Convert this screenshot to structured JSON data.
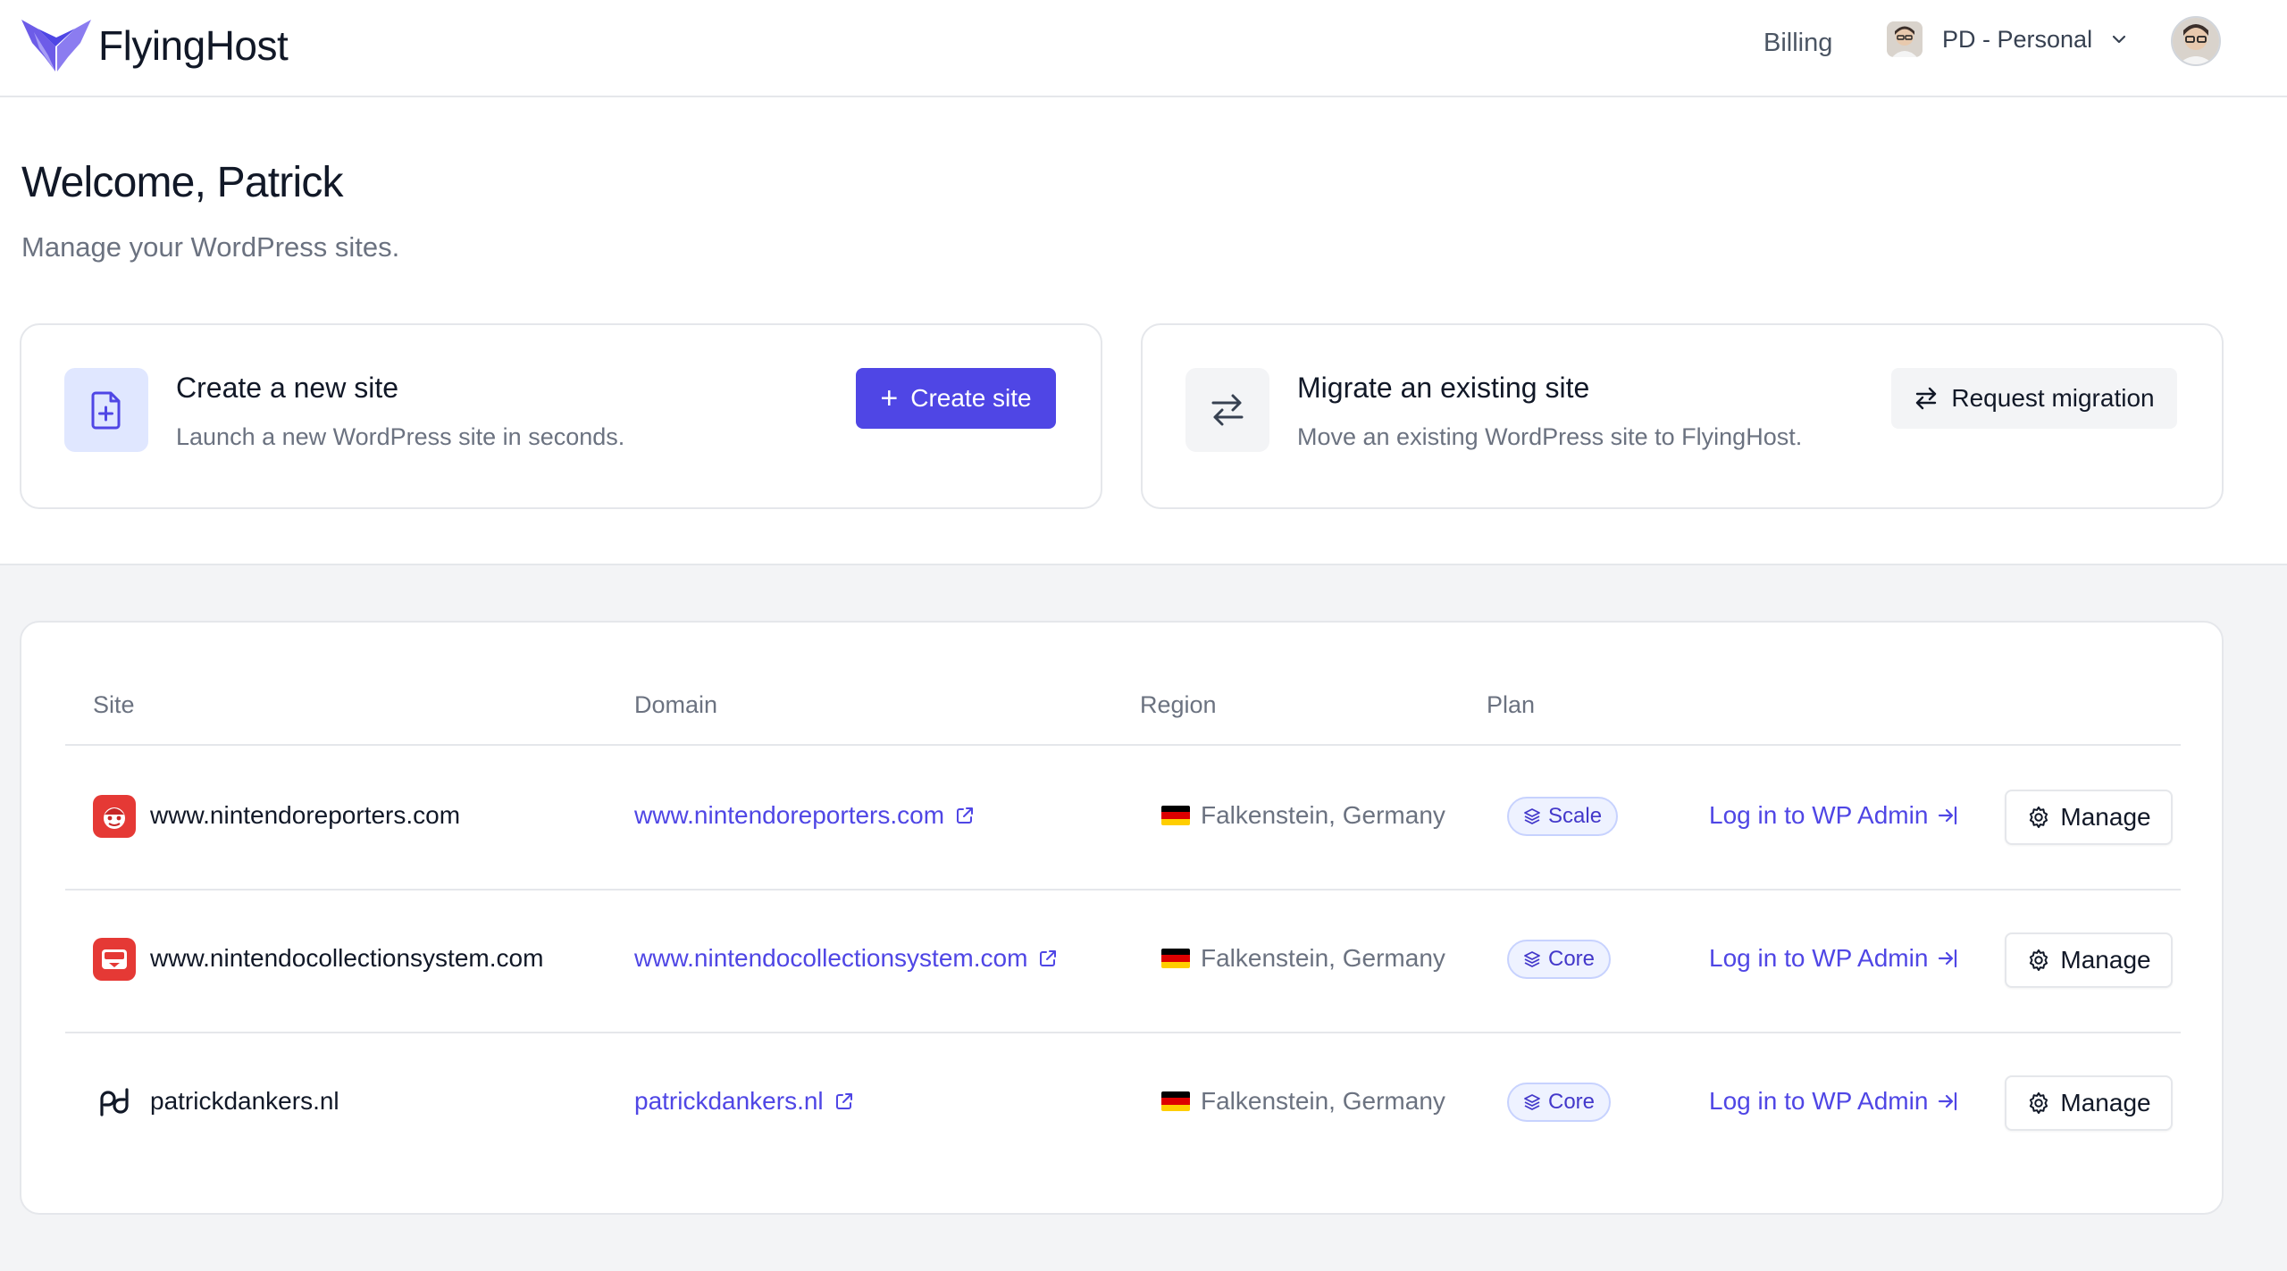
{
  "header": {
    "brand": "FlyingHost",
    "billing_label": "Billing",
    "org_label": "PD - Personal",
    "icons": {
      "logo": "flyinghost-logo",
      "org_avatar": "avatar-icon",
      "org_chevron": "chevron-down-icon",
      "user_avatar": "avatar-icon"
    }
  },
  "hero": {
    "title": "Welcome, Patrick",
    "subtitle": "Manage your WordPress sites.",
    "create_card": {
      "title": "Create a new site",
      "description": "Launch a new WordPress site in seconds.",
      "button_label": "Create site",
      "icon": "file-plus-icon"
    },
    "migrate_card": {
      "title": "Migrate an existing site",
      "description": "Move an existing WordPress site to FlyingHost.",
      "button_label": "Request migration",
      "icon": "arrows-exchange-icon"
    }
  },
  "table": {
    "columns": {
      "site": "Site",
      "domain": "Domain",
      "region": "Region",
      "plan": "Plan"
    },
    "rows": [
      {
        "site": "www.nintendoreporters.com",
        "domain": "www.nintendoreporters.com",
        "region": "Falkenstein, Germany",
        "plan": "Scale",
        "wp_admin": "Log in to WP Admin",
        "manage": "Manage"
      },
      {
        "site": "www.nintendocollectionsystem.com",
        "domain": "www.nintendocollectionsystem.com",
        "region": "Falkenstein, Germany",
        "plan": "Core",
        "wp_admin": "Log in to WP Admin",
        "manage": "Manage"
      },
      {
        "site": "patrickdankers.nl",
        "domain": "patrickdankers.nl",
        "region": "Falkenstein, Germany",
        "plan": "Core",
        "wp_admin": "Log in to WP Admin",
        "manage": "Manage"
      }
    ]
  },
  "colors": {
    "accent": "#4f46e5",
    "badge_bg": "#eef2ff",
    "badge_border": "#c7d2fe",
    "site_icon_red": "#e53935"
  }
}
